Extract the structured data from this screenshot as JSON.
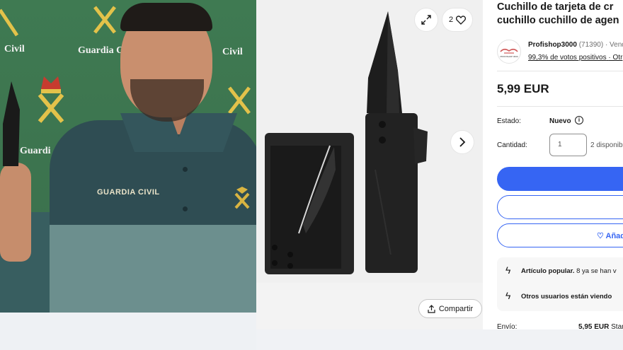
{
  "video": {
    "wall_texts": [
      "Civil",
      "Guardia C",
      "Civil",
      "Guardi"
    ],
    "shirt_label": "GUARDIA CIVIL"
  },
  "gallery": {
    "expand_icon": "expand-arrows-icon",
    "favorite_count": "2",
    "favorite_icon": "heart-icon",
    "next_icon": "chevron-right-icon",
    "share_label": "Compartir",
    "share_icon": "share-icon"
  },
  "listing": {
    "title_line1": "Cuchillo de tarjeta de cr",
    "title_line2": "cuchillo cuchillo de agen",
    "seller": {
      "logo_text": "PROFISHOP 3000",
      "name": "Profishop3000",
      "count": "(71390)",
      "suffix": "· Vend",
      "rating": "99,3% de votos positivos",
      "rating_suffix": "· Otr"
    },
    "price": "5,99 EUR",
    "condition_label": "Estado:",
    "condition_value": "Nuevo",
    "quantity_label": "Cantidad:",
    "quantity_value": "1",
    "quantity_available": "2 disponib",
    "watch_label": "♡ Añad",
    "notices": [
      {
        "bold": "Artículo popular.",
        "text": " 8 ya se han v"
      },
      {
        "bold": "Otros usuarios están viendo",
        "text": ""
      }
    ],
    "shipping_label": "Envío:",
    "shipping_value": "5,95 EUR",
    "shipping_suffix": " Stan"
  },
  "colors": {
    "accent": "#3665f3",
    "wall_green": "#3f7a52",
    "uniform": "#2f4d53"
  }
}
